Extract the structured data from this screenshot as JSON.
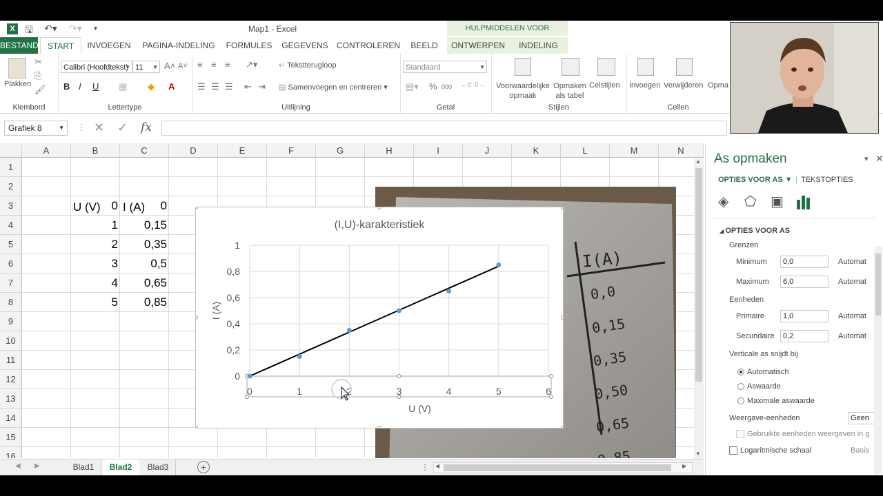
{
  "window": {
    "title": "Map1 - Excel",
    "context_group": "HULPMIDDELEN VOOR GRAFIEKEN"
  },
  "tabs": [
    "BESTAND",
    "START",
    "INVOEGEN",
    "PAGINA-INDELING",
    "FORMULES",
    "GEGEVENS",
    "CONTROLEREN",
    "BEELD",
    "ONTWERPEN",
    "INDELING"
  ],
  "ribbon": {
    "clipboard": {
      "paste": "Plakken",
      "label": "Klembord"
    },
    "font": {
      "name": "Calibri (Hoofdtekst)",
      "size": "11",
      "bold": "B",
      "italic": "I",
      "underline": "U",
      "label": "Lettertype"
    },
    "alignment": {
      "wrap": "Tekstterugloop",
      "merge": "Samenvoegen en centreren",
      "label": "Uitlijning"
    },
    "number": {
      "format": "Standaard",
      "percent": "%",
      "thousands": "000",
      "label": "Getal"
    },
    "styles": {
      "conditional": [
        "Voorwaardelijke",
        "opmaak"
      ],
      "table": [
        "Opmaken",
        "als tabel"
      ],
      "cell": "Celstijlen",
      "label": "Stijlen"
    },
    "cells": {
      "insert": "Invoegen",
      "delete": "Verwijderen",
      "format": "Opma",
      "label": "Cellen"
    }
  },
  "formula_bar": {
    "name_box": "Grafiek 8",
    "fx": "fx",
    "value": ""
  },
  "columns": [
    "A",
    "B",
    "C",
    "D",
    "E",
    "F",
    "G",
    "H",
    "I",
    "J",
    "K",
    "L",
    "M",
    "N"
  ],
  "rows": [
    "1",
    "2",
    "3",
    "4",
    "5",
    "6",
    "7",
    "8",
    "9",
    "10",
    "11",
    "12",
    "13",
    "14",
    "15",
    "16"
  ],
  "table": {
    "header_u": "U (V)",
    "header_i": "I (A)",
    "u": [
      "0",
      "1",
      "2",
      "3",
      "4",
      "5"
    ],
    "i": [
      "0",
      "0,15",
      "0,35",
      "0,5",
      "0,65",
      "0,85"
    ]
  },
  "photo_table": {
    "header": "I(A)",
    "values": [
      "0,0",
      "0,15",
      "0,35",
      "0,50",
      "0,65",
      "0,85"
    ]
  },
  "chart_data": {
    "type": "scatter",
    "title": "(I,U)-karakteristiek",
    "xlabel": "U (V)",
    "ylabel": "I (A)",
    "x": [
      0,
      1,
      2,
      3,
      4,
      5
    ],
    "y": [
      0,
      0.15,
      0.35,
      0.5,
      0.65,
      0.85
    ],
    "trendline": {
      "x": [
        0,
        5
      ],
      "y": [
        0,
        0.84
      ]
    },
    "xlim": [
      0,
      6
    ],
    "ylim": [
      0,
      1
    ],
    "x_ticks": [
      "0",
      "1",
      "2",
      "3",
      "4",
      "5",
      "6"
    ],
    "y_ticks": [
      "0",
      "0,2",
      "0,4",
      "0,6",
      "0,8",
      "1"
    ],
    "grid": true,
    "x_axis_selected": true
  },
  "sheets": [
    "Blad1",
    "Blad2",
    "Blad3"
  ],
  "active_sheet": "Blad2",
  "panel": {
    "title": "As opmaken",
    "tab_axis": "OPTIES VOOR AS",
    "tab_text": "TEKSTOPTIES",
    "section": "OPTIES VOOR AS",
    "bounds": "Grenzen",
    "minimum_label": "Minimum",
    "minimum_value": "0,0",
    "maximum_label": "Maximum",
    "maximum_value": "6,0",
    "auto": "Automat",
    "units": "Eenheden",
    "major_label": "Primaire",
    "major_value": "1,0",
    "minor_label": "Secundaire",
    "minor_value": "0,2",
    "crosses": "Verticale as snijdt bij",
    "opt_auto": "Automatisch",
    "opt_value": "Aswaarde",
    "opt_max": "Maximale aswaarde",
    "display_units": "Weergave-eenheden",
    "display_units_value": "Geen",
    "show_units": "Gebruikte eenheden weergeven in g",
    "log_scale": "Logaritmische schaal",
    "basis": "Basis"
  }
}
